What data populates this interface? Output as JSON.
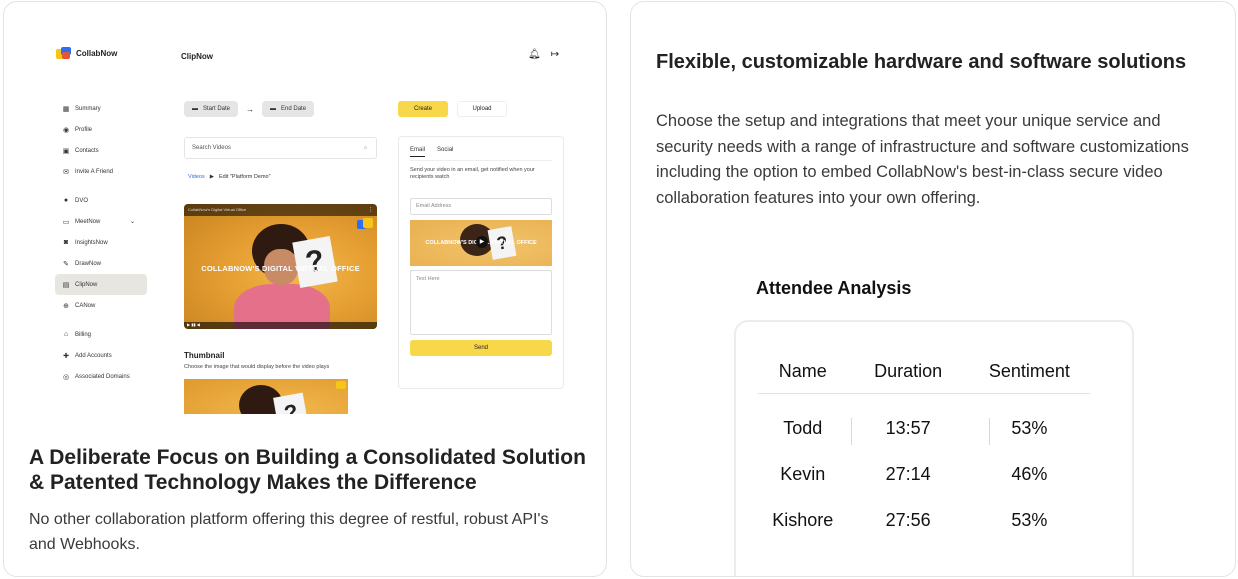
{
  "mockup": {
    "brand": "CollabNow",
    "app_title": "ClipNow",
    "icons": {
      "bell": "bell-icon",
      "logout": "logout-icon"
    },
    "sidebar": [
      {
        "label": "Summary",
        "icon": "grid-icon"
      },
      {
        "label": "Profile",
        "icon": "user-circle-icon"
      },
      {
        "label": "Contacts",
        "icon": "contacts-icon"
      },
      {
        "label": "Invite A Friend",
        "icon": "mail-icon"
      },
      {
        "label": "DVO",
        "icon": "microphone-icon"
      },
      {
        "label": "MeetNow",
        "icon": "monitor-icon"
      },
      {
        "label": "InsightsNow",
        "icon": "insights-icon"
      },
      {
        "label": "DrawNow",
        "icon": "brush-icon"
      },
      {
        "label": "ClipNow",
        "icon": "clip-icon",
        "active": true
      },
      {
        "label": "CANow",
        "icon": "search-plus-icon"
      },
      {
        "label": "Billing",
        "icon": "bank-icon"
      },
      {
        "label": "Add Accounts",
        "icon": "add-user-icon"
      },
      {
        "label": "Associated Domains",
        "icon": "globe-icon"
      }
    ],
    "start_date": "Start Date",
    "end_date": "End Date",
    "create": "Create",
    "upload": "Upload",
    "search_placeholder": "Search Videos",
    "crumb_videos": "Videos",
    "crumb_edit": "Edit \"Platform Demo\"",
    "video_topbar": "CollabNow's Digital Virtual Office",
    "video_text": "COLLABNOW'S DIGITAL VIRTUAL OFFICE",
    "thumbnail_title": "Thumbnail",
    "thumbnail_sub": "Choose the image that would display before the video plays",
    "share": {
      "tab_email": "Email",
      "tab_social": "Social",
      "description": "Send your video in an email, get notified when your recipients watch",
      "email_placeholder": "Email Address",
      "video_text": "COLLABNOW'S DIGITAL VIRTUAL OFFICE",
      "text_placeholder": "Text Here",
      "send": "Send"
    }
  },
  "left": {
    "heading": "A Deliberate Focus on Building a Consolidated Solution & Patented Technology Makes the Difference",
    "body": "No other collaboration platform offering this degree of restful, robust API's and Webhooks."
  },
  "right": {
    "heading": "Flexible, customizable hardware and software solutions",
    "body": "Choose the setup and integrations that meet your unique service and security needs with a range of infrastructure and software customizations including the option to embed CollabNow's best-in-class secure video collaboration features into your own offering.",
    "table_title": "Attendee Analysis",
    "columns": [
      "Name",
      "Duration",
      "Sentiment"
    ],
    "rows": [
      {
        "name": "Todd",
        "duration": "13:57",
        "sentiment": "53%"
      },
      {
        "name": "Kevin",
        "duration": "27:14",
        "sentiment": "46%"
      },
      {
        "name": "Kishore",
        "duration": "27:56",
        "sentiment": "53%"
      }
    ]
  }
}
